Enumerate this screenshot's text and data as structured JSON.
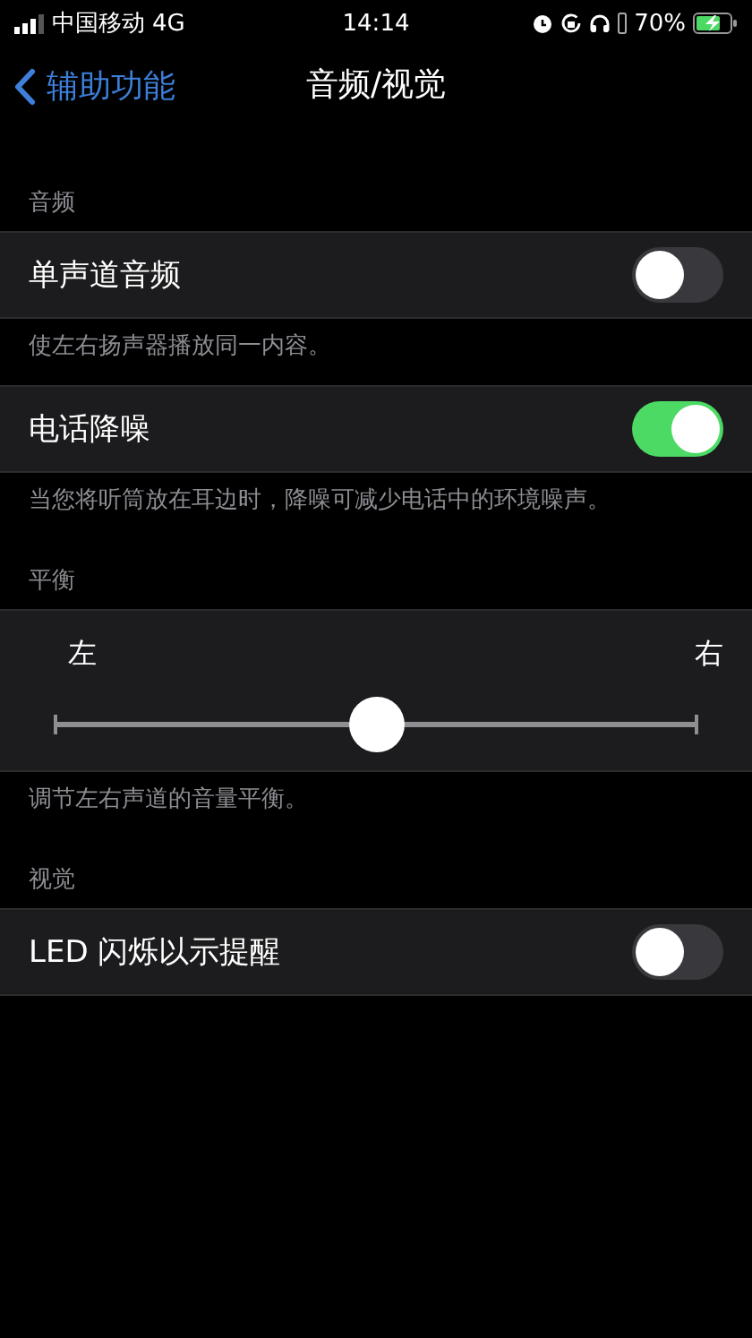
{
  "status_bar": {
    "carrier": "中国移动",
    "network": "4G",
    "time": "14:14",
    "battery": "70%",
    "charging": true
  },
  "nav": {
    "back": "辅助功能",
    "title": "音频/视觉"
  },
  "sections": [
    {
      "header": "音频",
      "rows": [
        {
          "kind": "toggle",
          "label": "单声道音频",
          "on": false
        }
      ],
      "footer": "使左右扬声器播放同一内容。"
    },
    {
      "rows": [
        {
          "kind": "toggle",
          "label": "电话降噪",
          "on": true
        }
      ],
      "footer": "当您将听筒放在耳边时，降噪可减少电话中的环境噪声。"
    },
    {
      "header": "平衡",
      "rows": [
        {
          "kind": "slider",
          "left": "左",
          "right": "右",
          "level": 0.5
        }
      ],
      "footer": "调节左右声道的音量平衡。"
    },
    {
      "header": "视觉",
      "rows": [
        {
          "kind": "toggle",
          "label": "LED 闪烁以示提醒",
          "on": false
        }
      ]
    }
  ]
}
